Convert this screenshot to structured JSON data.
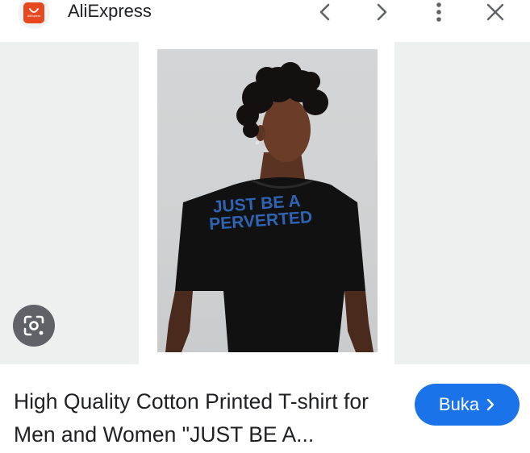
{
  "header": {
    "logo_text": "AliExpress",
    "title": "AliExpress",
    "icons": [
      "chevron-left-icon",
      "chevron-right-icon",
      "more-vert-icon",
      "close-icon"
    ]
  },
  "image": {
    "shirt_text_line1": "JUST BE A",
    "shirt_text_line2": "PERVERTED"
  },
  "caption": {
    "text": "High Quality Cotton Printed T-shirt for Men and Women \"JUST BE A..."
  },
  "action": {
    "open_label": "Buka",
    "open_icon": "chevron-right-icon"
  },
  "colors": {
    "brand": "#e8481f",
    "button": "#1a73e8",
    "side_panel": "#eef0f0",
    "lens_button": "#5f6368",
    "shirt_text": "#2f64b4"
  }
}
